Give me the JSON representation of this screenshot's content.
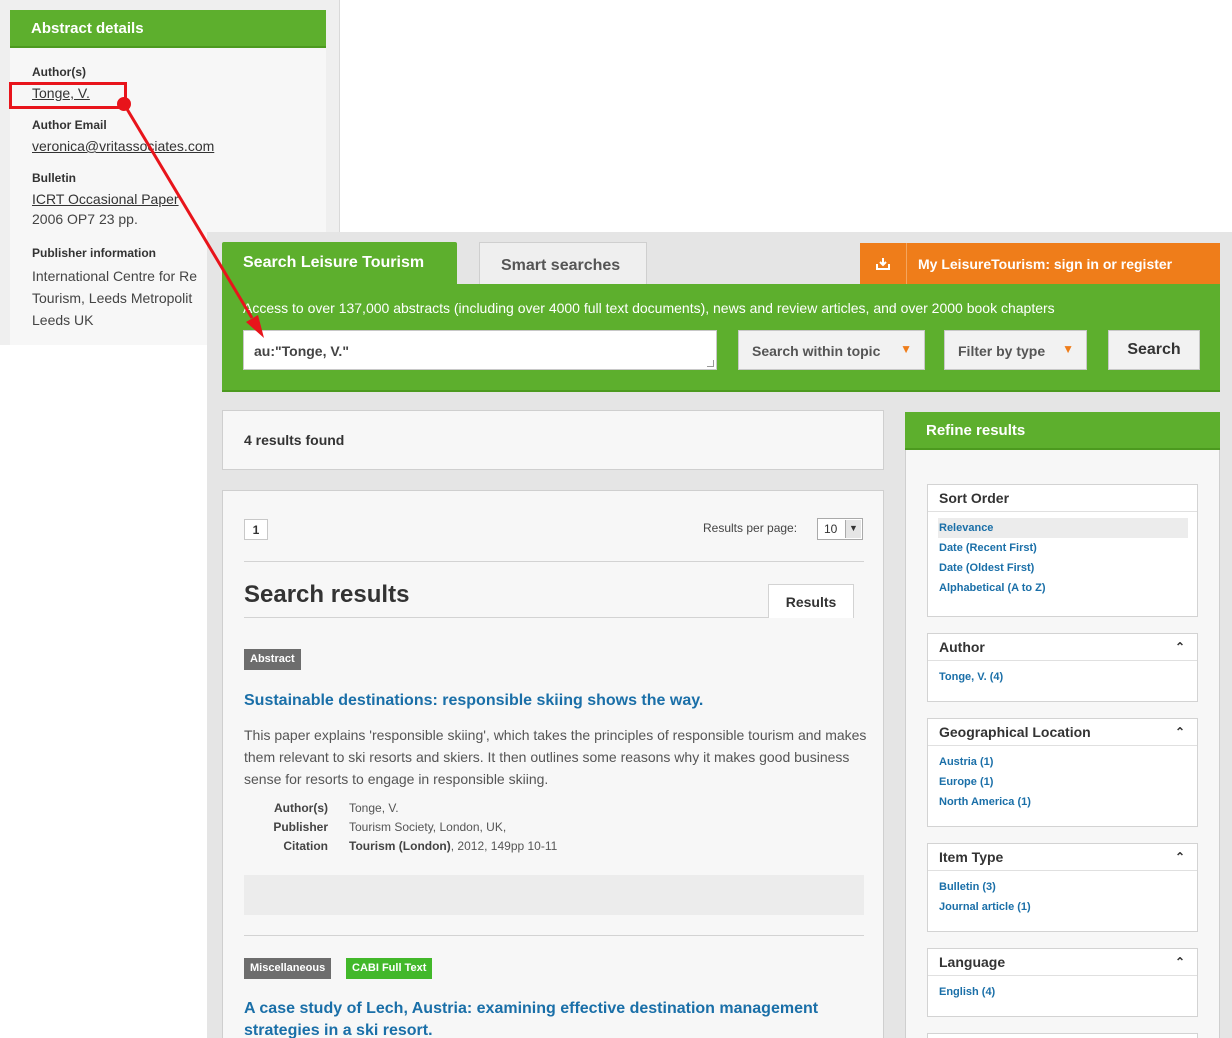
{
  "abstract_panel": {
    "header": "Abstract details",
    "authors_label": "Author(s)",
    "author": "Tonge, V.",
    "email_label": "Author Email",
    "email": "veronica@vritassociates.com",
    "bulletin_label": "Bulletin",
    "bulletin_link": "ICRT Occasional Paper",
    "bulletin_detail": "2006  OP7 23 pp.",
    "publisher_label": "Publisher information",
    "publisher_lines": [
      "International Centre for Re",
      "Tourism, Leeds Metropolit",
      "Leeds UK"
    ]
  },
  "header": {
    "tab_active": "Search Leisure Tourism",
    "tab_inactive": "Smart searches",
    "signin_label": "My LeisureTourism: sign in or register"
  },
  "search": {
    "banner": "Access to over 137,000 abstracts (including over 4000 full text documents), news and review articles, and over 2000 book chapters",
    "query": "au:\"Tonge, V.\"",
    "topic_dropdown": "Search within topic",
    "type_dropdown": "Filter by type",
    "button": "Search"
  },
  "results": {
    "count_text": "4 results found",
    "page": "1",
    "per_page_label": "Results per page:",
    "per_page_value": "10",
    "title": "Search results",
    "tab": "Results",
    "items": [
      {
        "badges": [
          "Abstract"
        ],
        "title": "Sustainable destinations: responsible skiing shows the way.",
        "description": "This paper explains 'responsible skiing', which takes the principles of responsible tourism and makes them relevant to ski resorts and skiers. It then outlines some reasons why it makes good business sense for resorts to engage in responsible skiing.",
        "meta": {
          "author_label": "Author(s)",
          "author": "Tonge, V.",
          "publisher_label": "Publisher",
          "publisher": "Tourism Society, London, UK,",
          "citation_label": "Citation",
          "citation_bold": "Tourism (London)",
          "citation_rest": ", 2012, 149pp 10-11"
        }
      },
      {
        "badges": [
          "Miscellaneous",
          "CABI Full Text"
        ],
        "title": "A case study of Lech, Austria: examining effective destination management strategies in a ski resort."
      }
    ]
  },
  "refine": {
    "header": "Refine results",
    "sort": {
      "title": "Sort Order",
      "items": [
        "Relevance",
        "Date (Recent First)",
        "Date (Oldest First)",
        "Alphabetical (A to Z)"
      ]
    },
    "author": {
      "title": "Author",
      "items": [
        "Tonge, V. (4)"
      ]
    },
    "geo": {
      "title": "Geographical Location",
      "items": [
        "Austria (1)",
        "Europe (1)",
        "North America (1)"
      ]
    },
    "item_type": {
      "title": "Item Type",
      "items": [
        "Bulletin (3)",
        "Journal article (1)"
      ]
    },
    "language": {
      "title": "Language",
      "items": [
        "English (4)"
      ]
    }
  },
  "colors": {
    "brand_green": "#5daf2d",
    "accent_orange": "#ef7d1a",
    "link_blue": "#1a6fa8",
    "annotation_red": "#e8141b"
  }
}
